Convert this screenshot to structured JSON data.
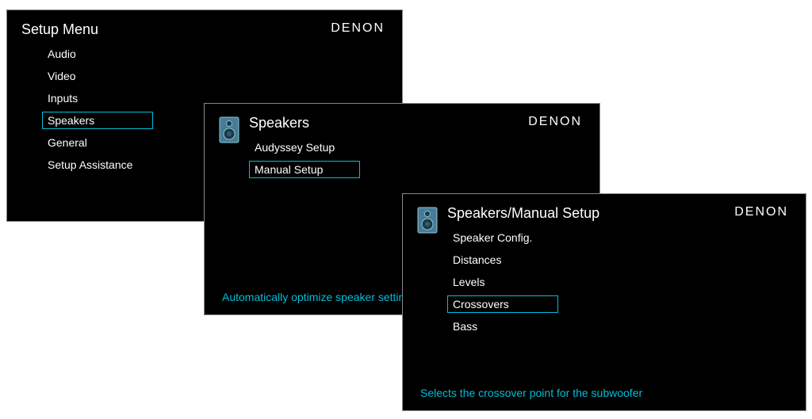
{
  "brand": "DENON",
  "panel1": {
    "title": "Setup Menu",
    "items": [
      {
        "label": "Audio",
        "selected": false
      },
      {
        "label": "Video",
        "selected": false
      },
      {
        "label": "Inputs",
        "selected": false
      },
      {
        "label": "Speakers",
        "selected": true
      },
      {
        "label": "General",
        "selected": false
      },
      {
        "label": "Setup Assistance",
        "selected": false
      }
    ]
  },
  "panel2": {
    "title": "Speakers",
    "items": [
      {
        "label": "Audyssey Setup",
        "selected": false
      },
      {
        "label": "Manual Setup",
        "selected": true
      }
    ],
    "hint": "Automatically optimize speaker setting"
  },
  "panel3": {
    "title": "Speakers/Manual Setup",
    "items": [
      {
        "label": "Speaker Config.",
        "selected": false
      },
      {
        "label": "Distances",
        "selected": false
      },
      {
        "label": "Levels",
        "selected": false
      },
      {
        "label": "Crossovers",
        "selected": true
      },
      {
        "label": "Bass",
        "selected": false
      }
    ],
    "hint": "Selects the crossover point for the subwoofer"
  }
}
